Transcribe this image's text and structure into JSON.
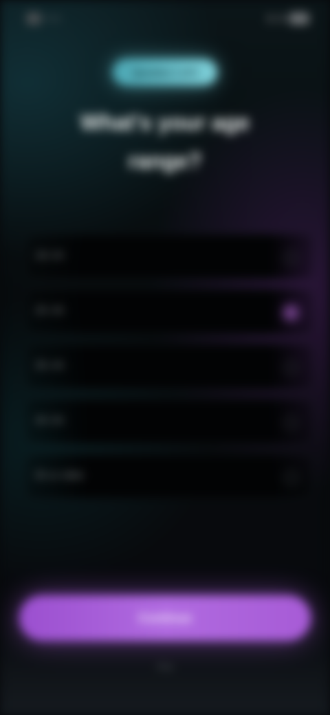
{
  "status_bar": {
    "time": "9:41"
  },
  "header": {
    "pill_label": "Question 1 of 5",
    "title": "What's your age range?"
  },
  "options": [
    {
      "label": "18–24",
      "selected": false
    },
    {
      "label": "25–34",
      "selected": true
    },
    {
      "label": "35–44",
      "selected": false
    },
    {
      "label": "45–54",
      "selected": false
    },
    {
      "label": "55 or older",
      "selected": false
    }
  ],
  "footer": {
    "continue_label": "Continue",
    "skip_label": "Skip"
  },
  "colors": {
    "accent": "#b06ae0",
    "pill": "#7fd0d9"
  }
}
